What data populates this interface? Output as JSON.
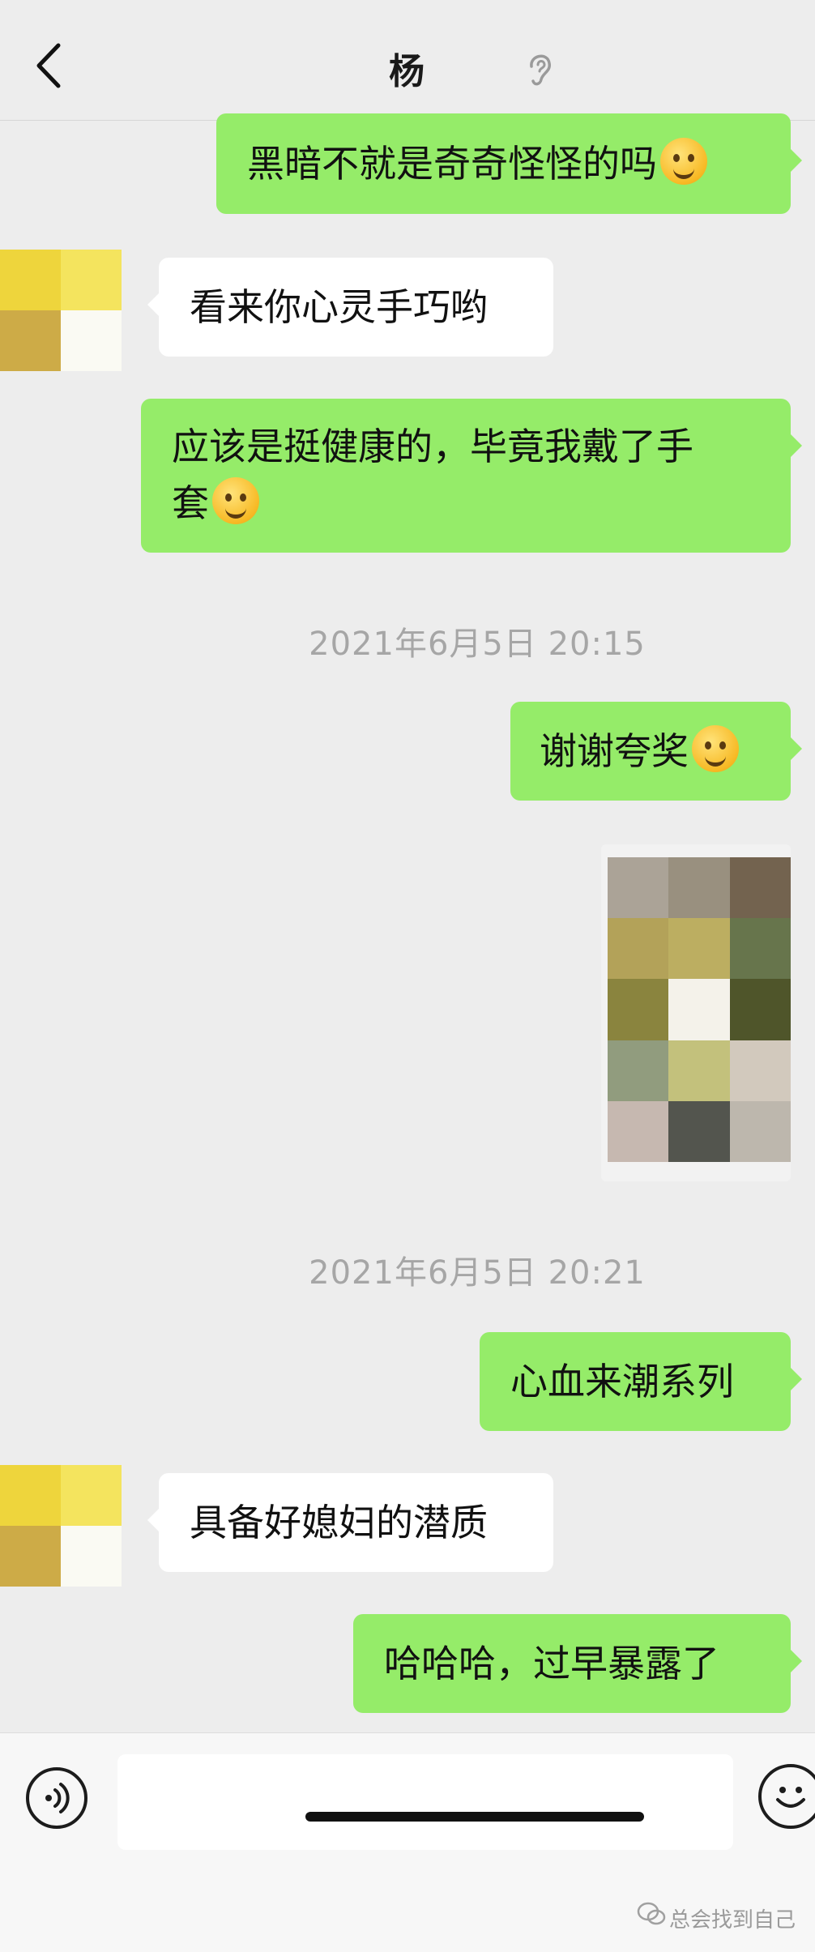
{
  "header": {
    "title": "杨"
  },
  "messages": [
    {
      "type": "sent",
      "text": "黑暗不就是奇奇怪怪的吗",
      "emoji": "tears-of-joy-emoji"
    },
    {
      "type": "recv",
      "text": "看来你心灵手巧哟"
    },
    {
      "type": "sent",
      "line1": "应该是挺健康的，毕竟我戴了手",
      "line2": "套",
      "emoji": "winking-tongue-emoji"
    },
    {
      "type": "time",
      "text": "2021年6月5日 20:15"
    },
    {
      "type": "sent",
      "text": "谢谢夸奖",
      "emoji": "grinning-squint-emoji"
    },
    {
      "type": "image",
      "content": "pixelated-photo"
    },
    {
      "type": "time",
      "text": "2021年6月5日 20:21"
    },
    {
      "type": "sent",
      "text": "心血来潮系列"
    },
    {
      "type": "recv",
      "text": "具备好媳妇的潜质"
    },
    {
      "type": "sent",
      "text": "哈哈哈，过早暴露了"
    }
  ],
  "input": {
    "placeholder": ""
  },
  "watermark": {
    "text": "总会找到自己"
  },
  "colors": {
    "sent_bubble": "#95ec69",
    "recv_bubble": "#ffffff",
    "background": "#ededed",
    "avatar": [
      "#eed53c",
      "#f4e45e",
      "#cdab47",
      "#fafaf3"
    ],
    "photo_pixels": [
      "#aba397",
      "#99907f",
      "#73634f",
      "#b3a259",
      "#bcae61",
      "#67754c",
      "#8a843e",
      "#f4f2ea",
      "#4f552a",
      "#919c7e",
      "#c3c17c",
      "#d2c9bd",
      "#c6b8b0",
      "#53554e",
      "#bdb7ad"
    ]
  },
  "icons": [
    "back-icon",
    "ear-icon",
    "voice-icon",
    "emoji-icon",
    "wechat-logo-icon"
  ]
}
